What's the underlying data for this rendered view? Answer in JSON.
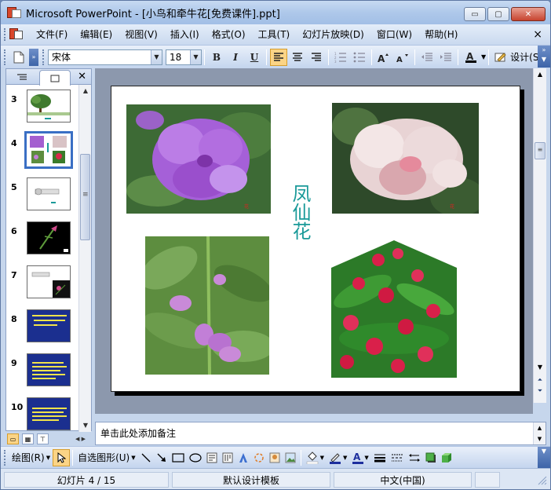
{
  "window": {
    "title": "Microsoft PowerPoint - [小鸟和牵牛花[免费课件].ppt]",
    "controls": {
      "minimize": "▭",
      "maximize": "▢",
      "close": "✕"
    }
  },
  "menu": {
    "items": [
      "文件(F)",
      "编辑(E)",
      "视图(V)",
      "插入(I)",
      "格式(O)",
      "工具(T)",
      "幻灯片放映(D)",
      "窗口(W)",
      "帮助(H)"
    ],
    "close": "×"
  },
  "toolbar": {
    "font_name": "宋体",
    "font_size": "18",
    "bold": "B",
    "italic": "I",
    "underline": "U",
    "design_label": "设计(S)"
  },
  "slide_pane": {
    "thumbnails": [
      {
        "number": "3",
        "kind": "tree"
      },
      {
        "number": "4",
        "kind": "flowers",
        "selected": true
      },
      {
        "number": "5",
        "kind": "white"
      },
      {
        "number": "6",
        "kind": "dark"
      },
      {
        "number": "7",
        "kind": "mixed"
      },
      {
        "number": "8",
        "kind": "blue"
      },
      {
        "number": "9",
        "kind": "blue"
      },
      {
        "number": "10",
        "kind": "blue"
      }
    ]
  },
  "slide": {
    "title": "凤仙花"
  },
  "notes": {
    "placeholder": "单击此处添加备注"
  },
  "drawing_toolbar": {
    "draw_label": "绘图(R)",
    "autoshape_label": "自选图形(U)"
  },
  "status": {
    "slide_counter": "幻灯片 4 / 15",
    "design_template": "默认设计模板",
    "language": "中文(中国)"
  },
  "colors": {
    "title_teal": "#1a9a99",
    "selection_blue": "#3a6fc4",
    "active_button": "#fbd486"
  }
}
